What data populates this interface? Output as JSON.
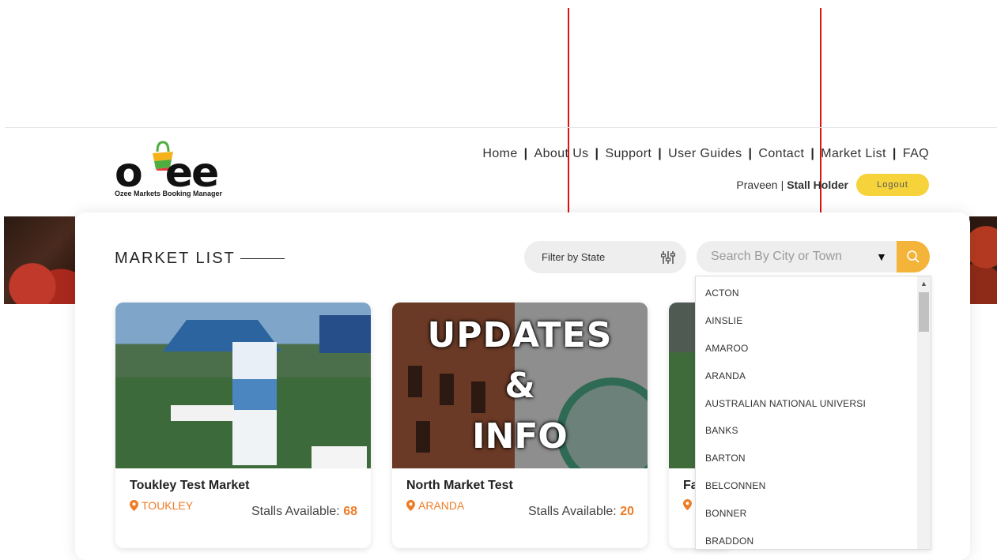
{
  "logo": {
    "mark": "ozee",
    "tagline": "Ozee Markets Booking Manager"
  },
  "nav": {
    "items": [
      "Home",
      "About Us",
      "Support",
      "User Guides",
      "Contact",
      "Market List",
      "FAQ"
    ],
    "separator": "|"
  },
  "user": {
    "name": "Praveen",
    "separator": "|",
    "role": "Stall Holder",
    "logout_label": "Logout"
  },
  "page": {
    "title": "MARKET LIST"
  },
  "filter": {
    "label": "Filter by State"
  },
  "search": {
    "placeholder": "Search By City or Town",
    "caret": "▼"
  },
  "cards": [
    {
      "name": "Toukley Test Market",
      "location": "TOUKLEY",
      "stalls_label": "Stalls Available:",
      "stalls_count": "68"
    },
    {
      "name": "North Market Test",
      "location": "ARANDA",
      "stalls_label": "Stalls Available:",
      "stalls_count": "20",
      "image_text": [
        "UPDATES",
        "&",
        "INFO"
      ]
    },
    {
      "name": "Fa",
      "location": ""
    }
  ],
  "city_dropdown": {
    "options": [
      "ACTON",
      "AINSLIE",
      "AMAROO",
      "ARANDA",
      "AUSTRALIAN NATIONAL UNIVERSI",
      "BANKS",
      "BARTON",
      "BELCONNEN",
      "BONNER",
      "BRADDON"
    ]
  },
  "colors": {
    "accent_orange": "#f07b25",
    "logout_yellow": "#f6d33b",
    "search_button": "#f4b43a",
    "annotation_red": "#e01010"
  }
}
